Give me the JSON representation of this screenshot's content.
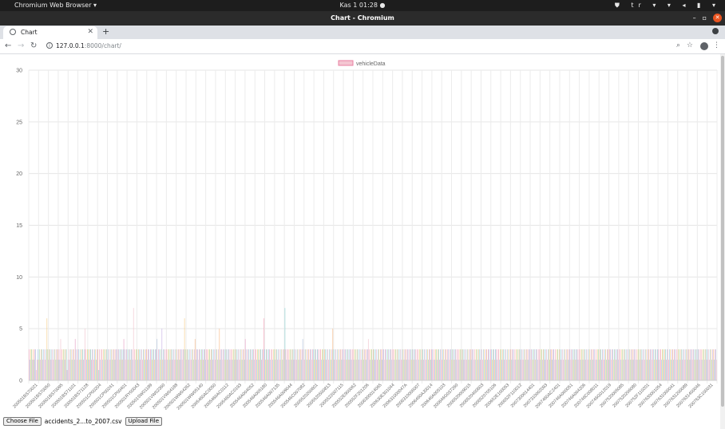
{
  "os_bar": {
    "app_menu": "Chromium Web Browser ▾",
    "clock": "Kas 1  01:28  ●",
    "lang": "tr ▾"
  },
  "window": {
    "title": "Chart - Chromium"
  },
  "tabs": [
    {
      "label": "Chart"
    }
  ],
  "address": {
    "host": "127.0.0.1",
    "path": ":8000/chart/"
  },
  "file_form": {
    "choose_label": "Choose File",
    "file_name": "accidents_2...to_2007.csv",
    "upload_label": "Upload File"
  },
  "colors": {
    "close": "#e95420",
    "bar_fill": "#f4c6d2",
    "bar_stroke": "#e97fa0"
  },
  "chart_data": {
    "type": "bar",
    "legend": "vehicleData",
    "legend_position": "top",
    "ylim": [
      0,
      30
    ],
    "yticks": [
      "0",
      "5",
      "10",
      "15",
      "20",
      "25",
      "30"
    ],
    "grid": true,
    "x_tick_labels": [
      "200501BS70021",
      "200501BS70050",
      "200501BS70095",
      "200501BS71101",
      "200501BS71128",
      "200501CP00204",
      "200501CP00241",
      "200501CP00401",
      "200501RY00043",
      "200501SW01189",
      "200501VW02360",
      "200501VW04188",
      "200501WW04262",
      "200501WW05140",
      "2005460AC0050",
      "2005460AC0112",
      "2005460AC0193",
      "200546A004052",
      "200546A005180",
      "200546A007135",
      "200546A009044",
      "200546C007082",
      "2005520200601",
      "2005520500813",
      "2005522007115",
      "200552E900062",
      "200552F201206",
      "2006300014065",
      "200630E301044",
      "200631000047A",
      "2006310006007",
      "2006460AJ0014",
      "200646A005103",
      "200646G037260",
      "2006520009015",
      "2006520400603",
      "2006520705106",
      "200652E100053",
      "200652F110012",
      "2007300014401",
      "2007310002093",
      "2007460AC2401",
      "200746A000051",
      "200746A004206",
      "200746C008011",
      "200746G012019",
      "2007520005085",
      "2007520206080",
      "200752F110201",
      "2007630001054",
      "2007631000041",
      "2007631200089",
      "2007631400046",
      "200763C100031"
    ],
    "values": [
      3,
      2,
      3,
      3,
      2,
      3,
      2,
      3,
      3,
      1,
      2,
      3,
      2,
      3,
      2,
      3,
      3,
      2,
      3,
      3,
      2,
      3,
      6,
      3,
      2,
      3,
      3,
      2,
      3,
      3,
      2,
      3,
      3,
      2,
      3,
      3,
      2,
      3,
      2,
      4,
      3,
      2,
      3,
      3,
      2,
      3,
      3,
      1,
      2,
      3,
      2,
      3,
      3,
      2,
      3,
      3,
      2,
      4,
      3,
      2,
      3,
      3,
      2,
      3,
      2,
      3,
      3,
      2,
      3,
      5,
      3,
      2,
      3,
      3,
      2,
      3,
      3,
      2,
      3,
      3,
      2,
      3,
      3,
      2,
      3,
      3,
      1,
      3,
      2,
      3,
      3,
      2,
      3,
      3,
      2,
      3,
      3,
      2,
      3,
      3,
      2,
      3,
      3,
      2,
      3,
      3,
      2,
      3,
      3,
      2,
      3,
      3,
      2,
      3,
      3,
      2,
      3,
      4,
      3,
      2,
      3,
      3,
      2,
      3,
      3,
      2,
      3,
      3,
      2,
      7,
      3,
      2,
      3,
      3,
      2,
      3,
      3,
      2,
      3,
      3,
      2,
      3,
      3,
      2,
      3,
      3,
      2,
      3,
      3,
      2,
      3,
      3,
      2,
      3,
      3,
      2,
      3,
      3,
      4,
      2,
      3,
      3,
      2,
      3,
      5,
      2,
      3,
      3,
      2,
      3,
      3,
      2,
      3,
      3,
      2,
      3,
      3,
      2,
      3,
      3,
      2,
      3,
      3,
      2,
      3,
      3,
      2,
      3,
      3,
      2,
      3,
      3,
      6,
      3,
      2,
      3,
      3,
      2,
      3,
      3,
      2,
      3,
      3,
      2,
      3,
      4,
      2,
      3,
      3,
      2,
      3,
      3,
      2,
      3,
      3,
      2,
      3,
      3,
      2,
      3,
      3,
      2,
      3,
      3,
      2,
      3,
      3,
      2,
      3,
      3,
      2,
      3,
      3,
      2,
      3,
      5,
      2,
      3,
      3,
      2,
      3,
      3,
      2,
      3,
      3,
      2,
      3,
      3,
      2,
      3,
      3,
      2,
      3,
      3,
      2,
      3,
      3,
      2,
      3,
      3,
      2,
      3,
      3,
      2,
      3,
      3,
      2,
      4,
      3,
      2,
      3,
      3,
      2,
      3,
      3,
      2,
      3,
      3,
      2,
      3,
      3,
      2,
      3,
      3,
      2,
      3,
      3,
      2,
      3,
      3,
      6,
      3,
      2,
      3,
      3,
      2,
      3,
      3,
      2,
      3,
      3,
      2,
      3,
      3,
      2,
      3,
      3,
      2,
      3,
      3,
      2,
      3,
      3,
      2,
      3,
      3,
      7,
      3,
      2,
      3,
      3,
      2,
      3,
      3,
      2,
      3,
      3,
      2,
      3,
      3,
      2,
      3,
      3,
      2,
      3,
      3,
      2,
      3,
      4,
      3,
      2,
      3,
      3,
      2,
      3,
      3,
      2,
      3,
      3,
      2,
      3,
      3,
      2,
      3,
      3,
      2,
      3,
      3,
      2,
      3,
      3,
      2,
      3,
      3,
      2,
      3,
      3,
      2,
      3,
      3,
      2,
      3,
      3,
      2,
      3,
      5,
      3,
      2,
      3,
      3,
      2,
      3,
      3,
      2,
      3,
      3,
      2,
      3,
      3,
      2,
      3,
      3,
      2,
      3,
      3,
      2,
      3,
      3,
      2,
      3,
      3,
      2,
      3,
      3,
      2,
      3,
      3,
      2,
      3,
      3,
      2,
      3,
      3,
      2,
      3,
      3,
      2,
      3,
      3,
      4,
      3,
      2,
      3,
      3,
      2,
      3,
      3,
      2,
      3,
      3,
      2,
      3,
      3,
      2,
      3,
      3,
      2,
      3,
      3,
      2,
      3,
      3,
      2,
      3,
      3,
      2,
      3,
      3,
      2,
      3,
      3,
      2,
      3,
      3,
      2,
      3,
      3,
      2,
      3,
      3,
      2,
      3,
      3,
      2,
      3,
      3,
      2,
      3,
      3,
      2,
      3,
      3,
      2,
      3,
      3,
      2,
      3,
      3,
      2,
      3,
      3,
      2,
      3,
      3,
      2,
      3,
      3,
      2,
      3,
      3,
      2,
      3,
      3,
      2,
      3,
      3,
      2,
      3,
      3,
      2,
      3,
      2,
      3,
      3,
      2,
      3,
      3,
      2,
      3,
      3,
      2,
      3,
      3,
      2,
      3,
      3,
      2,
      3,
      3,
      2,
      3,
      3,
      2,
      3,
      3,
      2,
      3,
      3,
      2,
      3,
      3,
      2,
      3,
      3,
      2,
      3,
      3,
      2,
      3,
      3,
      2,
      3,
      3,
      2,
      3,
      3,
      2,
      3,
      3,
      2,
      3,
      2,
      3,
      3,
      2,
      3,
      3,
      2,
      3,
      3,
      2,
      3,
      3,
      2,
      3,
      3,
      2,
      3,
      3,
      2,
      3,
      3,
      2,
      3,
      3,
      2,
      3,
      3,
      2,
      3,
      3,
      2,
      3,
      3,
      2,
      3,
      3,
      2,
      3,
      3,
      2,
      3,
      3,
      2,
      3,
      3,
      2,
      3,
      3,
      2,
      3,
      2,
      3,
      3,
      2,
      3,
      3,
      2,
      3,
      3,
      2,
      3,
      3,
      2,
      3,
      3,
      2,
      3,
      3,
      2,
      3,
      3,
      2,
      3,
      3,
      2,
      3,
      3,
      2,
      3,
      3,
      2,
      3,
      3,
      2,
      3,
      3,
      2,
      3,
      3,
      2,
      3,
      3,
      2,
      3,
      3,
      2,
      3,
      3,
      2,
      3,
      2,
      3,
      3,
      2,
      3,
      3,
      2,
      3,
      3,
      2,
      3,
      3,
      2,
      3,
      3,
      2,
      3,
      3,
      2,
      3,
      3,
      2,
      3,
      3,
      2,
      3,
      3,
      2,
      3,
      3,
      2,
      3,
      3,
      2,
      3,
      3,
      2,
      3,
      3,
      2,
      3,
      3,
      2,
      3,
      3,
      2,
      3,
      3,
      2,
      3,
      2,
      3,
      3,
      2,
      3,
      3,
      2,
      3,
      3,
      2,
      3,
      3,
      2,
      3,
      3,
      2,
      3,
      3,
      2,
      3,
      3,
      2,
      3,
      3,
      2,
      3,
      3,
      2,
      3,
      3,
      2,
      3,
      3,
      2,
      3,
      3,
      2,
      3,
      3,
      2,
      3,
      3,
      2,
      3,
      3,
      2,
      3,
      3,
      2,
      3,
      2,
      3,
      3,
      2,
      3,
      3,
      2,
      3,
      3,
      2,
      3,
      3,
      2,
      3,
      3,
      2,
      3,
      3,
      2,
      3,
      3,
      2,
      3,
      3,
      2,
      3,
      3,
      2,
      3,
      3,
      2,
      3,
      3,
      2,
      3,
      3,
      2,
      3,
      3,
      2,
      3,
      3,
      2,
      3,
      3,
      2,
      3,
      3,
      2,
      3,
      2,
      3,
      3,
      2,
      3,
      3,
      2,
      3,
      3,
      2,
      3,
      3,
      2,
      3,
      3,
      2,
      3,
      3,
      2,
      3,
      3,
      2,
      3,
      3,
      2,
      3,
      3,
      2,
      3,
      3,
      2,
      3,
      3,
      2,
      3,
      3,
      2,
      3,
      3,
      2,
      3,
      3,
      2,
      3,
      3,
      2,
      3,
      3,
      2
    ]
  }
}
